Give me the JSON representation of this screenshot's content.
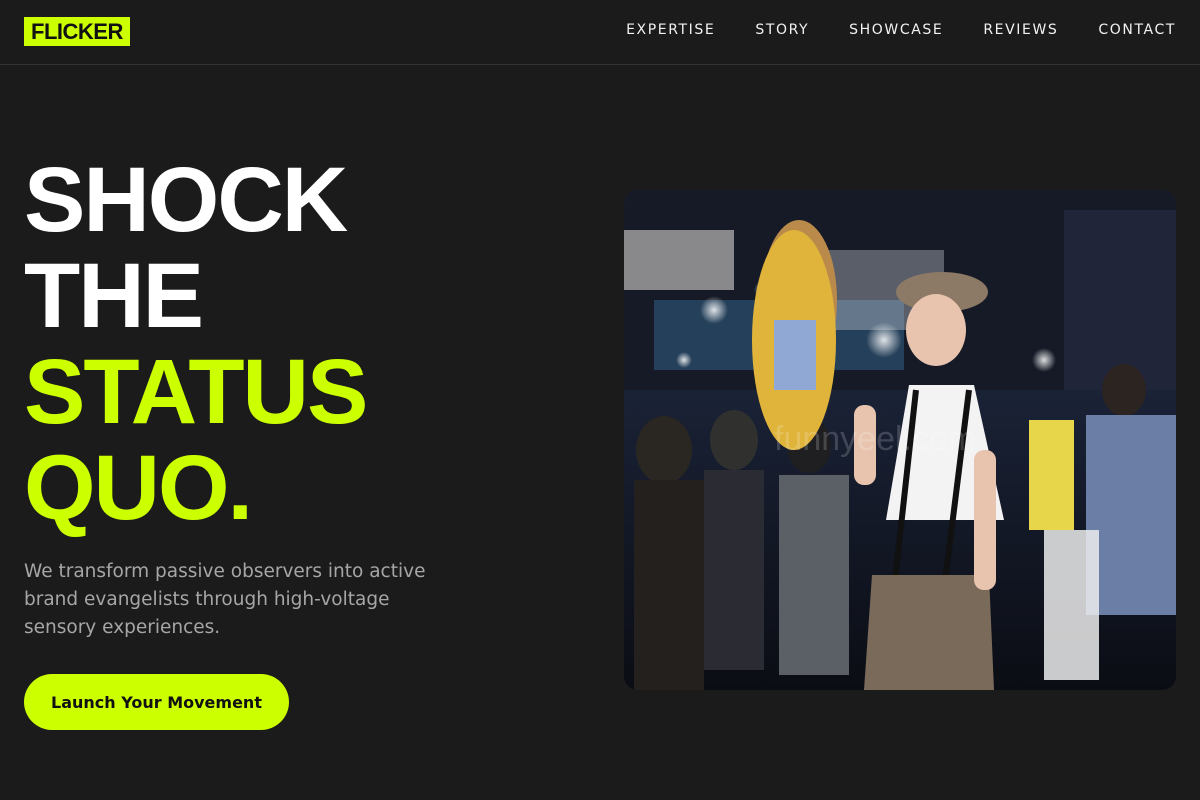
{
  "header": {
    "logo": "FLICKER",
    "nav": [
      "EXPERTISE",
      "STORY",
      "SHOWCASE",
      "REVIEWS",
      "CONTACT"
    ]
  },
  "hero": {
    "headline_white": [
      "SHOCK",
      "THE"
    ],
    "headline_accent": [
      "STATUS",
      "QUO."
    ],
    "tagline": "We transform passive observers into active brand evangelists through high-voltage sensory experiences.",
    "cta": "Launch Your Movement"
  },
  "photo": {
    "alt": "Smiling woman in cap and suspenders holding a lion cutout sign at a crowded expo",
    "watermark": "funnyeel.com"
  },
  "colors": {
    "background": "#1b1b1b",
    "accent": "#ccff00",
    "text": "#ffffff",
    "muted": "#a6a6a6"
  }
}
